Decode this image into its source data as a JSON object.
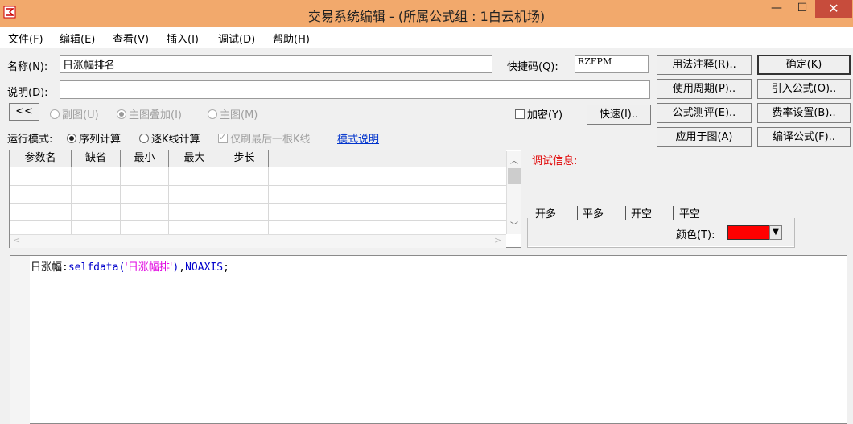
{
  "window": {
    "title": "交易系统编辑 - (所属公式组 : 1白云机场)",
    "minimize": "—",
    "maximize": "☐",
    "close": "✕"
  },
  "menu": [
    "文件(F)",
    "编辑(E)",
    "查看(V)",
    "插入(I)",
    "调试(D)",
    "帮助(H)"
  ],
  "form": {
    "name_label": "名称(N):",
    "name_value": "日涨幅排名",
    "shortcut_label": "快捷码(Q):",
    "shortcut_value": "RZFPM",
    "desc_label": "说明(D):",
    "desc_value": ""
  },
  "buttons": {
    "usage_notes": "用法注释(R)..",
    "ok": "确定(K)",
    "period": "使用周期(P)..",
    "import": "引入公式(O)..",
    "evaluate": "公式测评(E)..",
    "fee": "费率设置(B)..",
    "apply": "应用于图(A)",
    "compile": "编译公式(F)..",
    "quick": "快速(I)..",
    "back": "<<"
  },
  "options": {
    "sub_chart": "副图(U)",
    "main_overlay": "主图叠加(I)",
    "main_chart": "主图(M)",
    "encrypt": "加密(Y)",
    "run_mode_label": "运行模式:",
    "sequence_calc": "序列计算",
    "per_k_calc": "逐K线计算",
    "only_last": "仅刷最后一根K线",
    "mode_help": "模式说明"
  },
  "param_table": {
    "columns": [
      "参数名",
      "缺省",
      "最小",
      "最大",
      "步长"
    ],
    "rows": []
  },
  "debug": {
    "label": "调试信息:"
  },
  "tabs": [
    "开多",
    "平多",
    "开空",
    "平空"
  ],
  "color": {
    "label": "颜色(T):",
    "value": "#ff0000"
  },
  "editor": {
    "name": "日涨幅",
    "op": ":",
    "fn": "selfdata(",
    "str": "'日涨幅排'",
    "rest_close": ")",
    "comma": ",",
    "kw": "NOAXIS",
    "end": ";"
  }
}
